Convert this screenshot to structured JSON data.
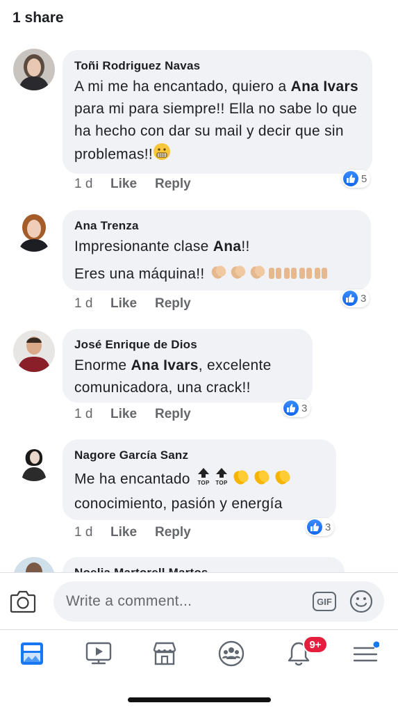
{
  "header": {
    "share_count": "1 share"
  },
  "comments": [
    {
      "author": "Toñi Rodriguez Navas",
      "text_parts": [
        "A mi me ha encantado, quiero a ",
        "Ana Ivars",
        " para mi para siempre!! Ella no sabe lo que ha hecho con dar su mail y decir que sin problemas!!"
      ],
      "time": "1 d",
      "like_label": "Like",
      "reply_label": "Reply",
      "reactions": "5",
      "emojis": [
        "grimacing-face"
      ]
    },
    {
      "author": "Ana Trenza",
      "line1_parts": [
        "Impresionante clase ",
        "Ana",
        "!!"
      ],
      "line2": "Eres una máquina!!",
      "time": "1 d",
      "like_label": "Like",
      "reply_label": "Reply",
      "reactions": "3",
      "emojis": [
        "clapping-hands",
        "clapping-hands",
        "clapping-hands",
        "raising-hands",
        "raising-hands",
        "raising-hands",
        "raising-hands"
      ]
    },
    {
      "author": "José Enrique de Dios",
      "text_parts": [
        "Enorme ",
        "Ana Ivars",
        ",  excelente comunicadora, una crack!!"
      ],
      "time": "1 d",
      "like_label": "Like",
      "reply_label": "Reply",
      "reactions": "3"
    },
    {
      "author": "Nagore García Sanz",
      "line1": "Me ha encantado",
      "line2": "conocimiento, pasión y energía",
      "top_label": "TOP",
      "time": "1 d",
      "like_label": "Like",
      "reply_label": "Reply",
      "reactions": "3",
      "emojis": [
        "top-arrow",
        "top-arrow",
        "clapping-hands",
        "clapping-hands",
        "clapping-hands"
      ]
    },
    {
      "author": "Noelia Martorell Martos"
    }
  ],
  "composer": {
    "placeholder": "Write a comment...",
    "gif_label": "GIF"
  },
  "tabbar": {
    "tabs": [
      "news-feed-icon",
      "watch-icon",
      "marketplace-icon",
      "groups-icon",
      "notifications-icon",
      "menu-icon"
    ],
    "notification_badge": "9+"
  },
  "colors": {
    "accent": "#1877f2",
    "badge": "#e41e3f",
    "bubble": "#f0f2f5",
    "secondary_text": "#65676b"
  }
}
